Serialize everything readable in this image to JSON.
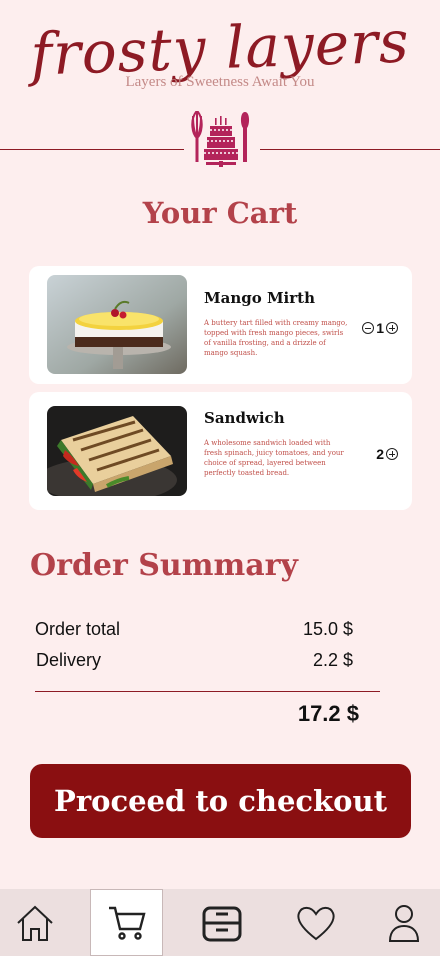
{
  "brand": {
    "name": "frosty layers",
    "tagline": "Layers of Sweetness Await You"
  },
  "cart": {
    "title": "Your Cart",
    "items": [
      {
        "name": "Mango Mirth",
        "description": "A buttery tart filled with creamy mango, topped with fresh mango pieces, swirls of vanilla frosting, and a drizzle of mango squash.",
        "quantity": "1",
        "image": "mango-cake-photo"
      },
      {
        "name": "Sandwich",
        "description": "A wholesome sandwich loaded with fresh spinach, juicy tomatoes, and your choice of spread, layered between perfectly toasted bread.",
        "quantity": "2",
        "image": "grilled-sandwich-photo"
      }
    ]
  },
  "summary": {
    "title": "Order Summary",
    "order_total_label": "Order total",
    "order_total_value": "15.0 $",
    "delivery_label": "Delivery",
    "delivery_value": "2.2 $",
    "grand_total": "17.2 $"
  },
  "checkout": {
    "label": "Proceed to checkout"
  },
  "nav": {
    "tabs": [
      {
        "icon": "home-icon",
        "active": false
      },
      {
        "icon": "cart-icon",
        "active": true
      },
      {
        "icon": "orders-box-icon",
        "active": false
      },
      {
        "icon": "heart-icon",
        "active": false
      },
      {
        "icon": "profile-icon",
        "active": false
      }
    ]
  },
  "colors": {
    "background": "#fdeeee",
    "brand": "#8d1a24",
    "heading": "#b3424a",
    "description": "#c0504a",
    "button": "#8a0f11",
    "tabbar": "#ecdfdf"
  }
}
